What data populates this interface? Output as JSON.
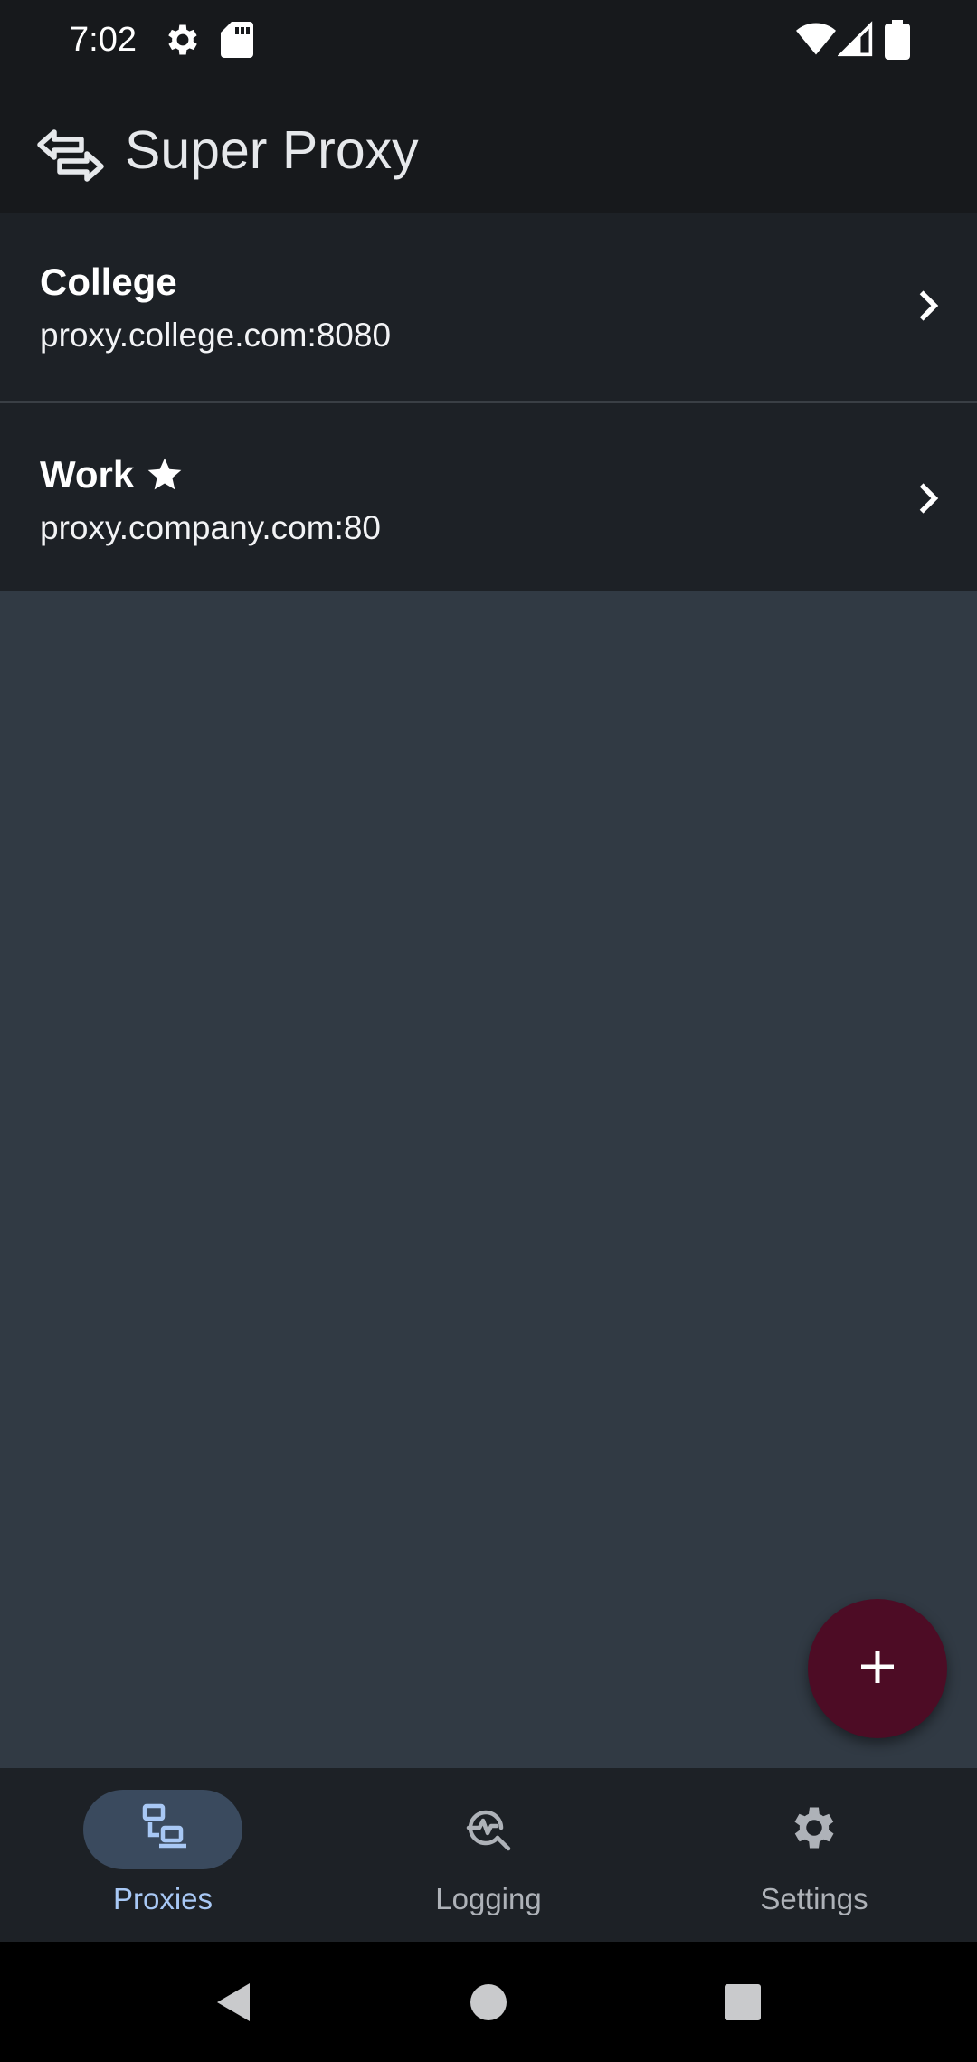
{
  "status_bar": {
    "time": "7:02",
    "icons": [
      "settings-gear-icon",
      "sd-card-icon",
      "wifi-icon",
      "signal-icon",
      "battery-icon"
    ]
  },
  "app_bar": {
    "title": "Super Proxy",
    "logo_icon": "swap-arrows-icon"
  },
  "proxies": [
    {
      "name": "College",
      "host": "proxy.college.com:8080",
      "default": false
    },
    {
      "name": "Work",
      "host": "proxy.company.com:80",
      "default": true
    }
  ],
  "fab": {
    "icon": "plus-icon",
    "color": "#4d0c25"
  },
  "bottom_nav": {
    "items": [
      {
        "label": "Proxies",
        "icon": "proxies-icon",
        "active": true
      },
      {
        "label": "Logging",
        "icon": "logging-icon",
        "active": false
      },
      {
        "label": "Settings",
        "icon": "settings-icon",
        "active": false
      }
    ]
  },
  "colors": {
    "background": "#313a44",
    "bar": "#17191c",
    "list_item": "#1d2126",
    "nav_active_pill": "#3a4a5e",
    "nav_active_label": "#a8c8f5"
  }
}
